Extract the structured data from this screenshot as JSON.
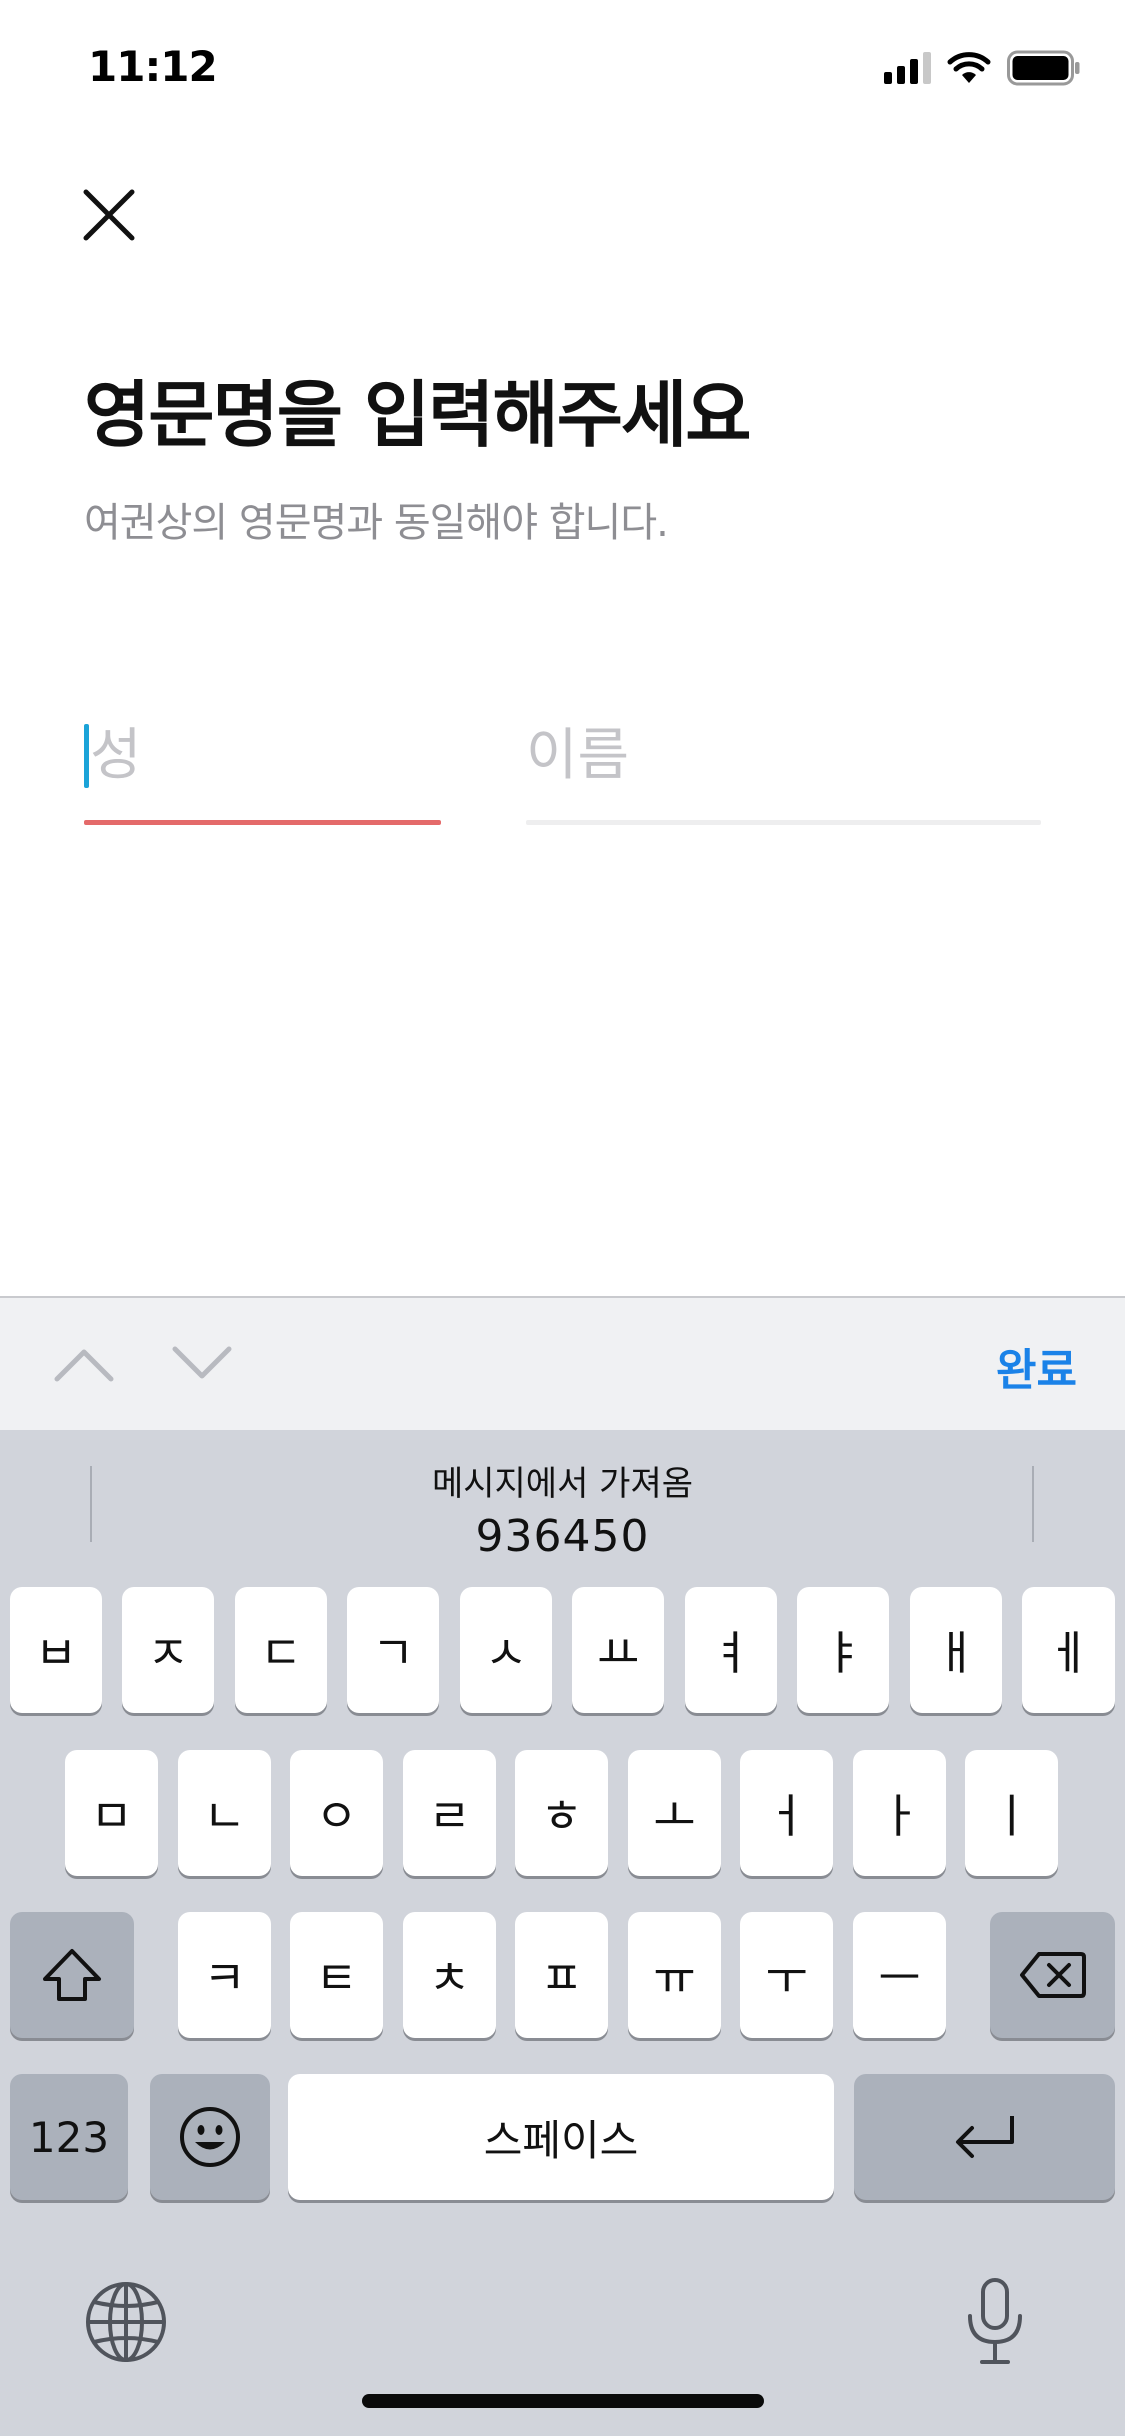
{
  "status_bar": {
    "time": "11:12"
  },
  "header": {
    "close_icon": "close-icon",
    "title": "영문명을 입력해주세요",
    "subtitle": "여권상의 영문명과 동일해야 합니다."
  },
  "form": {
    "last_name": {
      "value": "",
      "placeholder": "성"
    },
    "first_name": {
      "value": "",
      "placeholder": "이름"
    }
  },
  "keyboard_toolbar": {
    "done_label": "완료"
  },
  "suggestion": {
    "source": "메시지에서 가져옴",
    "code": "936450"
  },
  "keyboard": {
    "row1": [
      "ㅂ",
      "ㅈ",
      "ㄷ",
      "ㄱ",
      "ㅅ",
      "ㅛ",
      "ㅕ",
      "ㅑ",
      "ㅐ",
      "ㅔ"
    ],
    "row2": [
      "ㅁ",
      "ㄴ",
      "ㅇ",
      "ㄹ",
      "ㅎ",
      "ㅗ",
      "ㅓ",
      "ㅏ",
      "ㅣ"
    ],
    "row3": [
      "ㅋ",
      "ㅌ",
      "ㅊ",
      "ㅍ",
      "ㅠ",
      "ㅜ",
      "ㅡ"
    ],
    "numbers_label": "123",
    "space_label": "스페이스"
  },
  "colors": {
    "accent": "#1a82e8",
    "active_underline": "#e46a6a",
    "caret": "#1ba3d8"
  }
}
